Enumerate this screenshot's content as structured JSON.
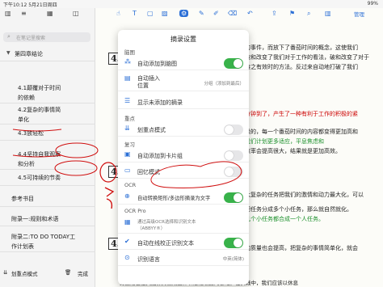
{
  "status": {
    "time": "下午10:12",
    "date": "5月21日周四",
    "battery": "99%"
  },
  "sidebar": {
    "search_placeholder": "在笔记里搜索",
    "items": [
      {
        "label": "第四章结论"
      },
      {
        "label": "4.1颠覆对于时间的依赖"
      },
      {
        "label": "4.2复杂的事情简单化"
      },
      {
        "label": "4.3放轻松"
      },
      {
        "label": "4.4坚持自我观察和分析"
      },
      {
        "label": "4.5可持续的节奏"
      },
      {
        "label": "参考书目"
      },
      {
        "label": "附录一:规则和术语"
      },
      {
        "label": "附录二:TO DO TODAY工作计划表"
      }
    ],
    "bottom_left": "划重点模式",
    "bottom_right": "完成"
  },
  "toolbar": {
    "right_label": "管理",
    "page_number": "1"
  },
  "popup": {
    "title": "摘录设置",
    "sections": {
      "mindmap": "脑图",
      "highlight": "重点",
      "review": "复习",
      "ocr": "OCR",
      "ocr_pro": "OCR Pro"
    },
    "rows": {
      "auto_add_mindmap": "自动添加到脑图",
      "auto_insert": "自动插入",
      "position": "位置",
      "position_option": "分组（添加到最后）",
      "show_unadded": "显示未添加的摘录",
      "highlight_mode": "划重点模式",
      "auto_card": "自动添加到卡片组",
      "recall_mode": "回忆模式",
      "auto_convert": "自动转换矩形/多边形摘录为文字",
      "ocr_service": "通过高级OCR选择和识别文本（ABBYY®）",
      "auto_online": "自动在线校正识别文本",
      "lang": "识别语言",
      "lang_option": "中英(简体)"
    }
  },
  "page_text": {
    "line1": "的事件，而放下了番茄时间的概念，这使我们",
    "line2": "破和改变了我们对于工作的看法，破和改变了对于",
    "line3": "持之有效时的方法。反过来自动地打破了我们",
    "line4": "分钟到了，产生了一种有利于工作的积极的紧",
    "line5": "极的，每一个番茄时间的内容都变得更加高和",
    "line6": "我们计划更多适应，平息焦虑和",
    "line7": "效率会提高很大，结果就是更加高效。",
    "line8": "太复杂的任务把我们的激情和动力最大化，可以",
    "line9": "把任务分成多个小任务，那么就自然就化。",
    "line10": "几个小任务都合成一个人任务。",
    "line11": "的质量也会提高，把复杂的事情简单化，就会",
    "line12": "劳逸结合是大脑保持高效工作和思维敏捷的基础。在实践中，我们应该以休息",
    "num4": "4."
  }
}
